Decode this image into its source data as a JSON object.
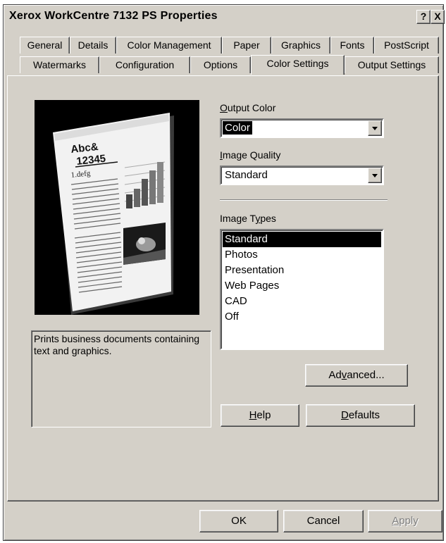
{
  "window": {
    "title": "Xerox WorkCentre 7132 PS Properties",
    "help_button": "?",
    "close_button": "X"
  },
  "tabs_row1": [
    {
      "label": "General"
    },
    {
      "label": "Details"
    },
    {
      "label": "Color Management"
    },
    {
      "label": "Paper"
    },
    {
      "label": "Graphics"
    },
    {
      "label": "Fonts"
    },
    {
      "label": "PostScript"
    }
  ],
  "tabs_row2": [
    {
      "label": "Watermarks"
    },
    {
      "label": "Configuration"
    },
    {
      "label": "Options"
    },
    {
      "label": "Color Settings",
      "active": true
    },
    {
      "label": "Output Settings"
    }
  ],
  "preview": {
    "heading_line1": "Abc&",
    "heading_line2": "12345",
    "subheading": "1.defg"
  },
  "description": "Prints business documents containing text and graphics.",
  "output_color": {
    "label_pre": "",
    "label_ul": "O",
    "label_post": "utput Color",
    "value": "Color"
  },
  "image_quality": {
    "label_pre": "",
    "label_ul": "I",
    "label_post": "mage Quality",
    "value": "Standard"
  },
  "image_types": {
    "label_pre": "Image T",
    "label_ul": "y",
    "label_post": "pes",
    "items": [
      "Standard",
      "Photos",
      "Presentation",
      "Web Pages",
      "CAD",
      "Off"
    ],
    "selected_index": 0
  },
  "buttons": {
    "advanced": {
      "pre": "Ad",
      "ul": "v",
      "post": "anced..."
    },
    "help": {
      "pre": "",
      "ul": "H",
      "post": "elp"
    },
    "defaults": {
      "pre": "",
      "ul": "D",
      "post": "efaults"
    },
    "ok": "OK",
    "cancel": "Cancel",
    "apply": {
      "pre": "",
      "ul": "A",
      "post": "pply"
    }
  }
}
